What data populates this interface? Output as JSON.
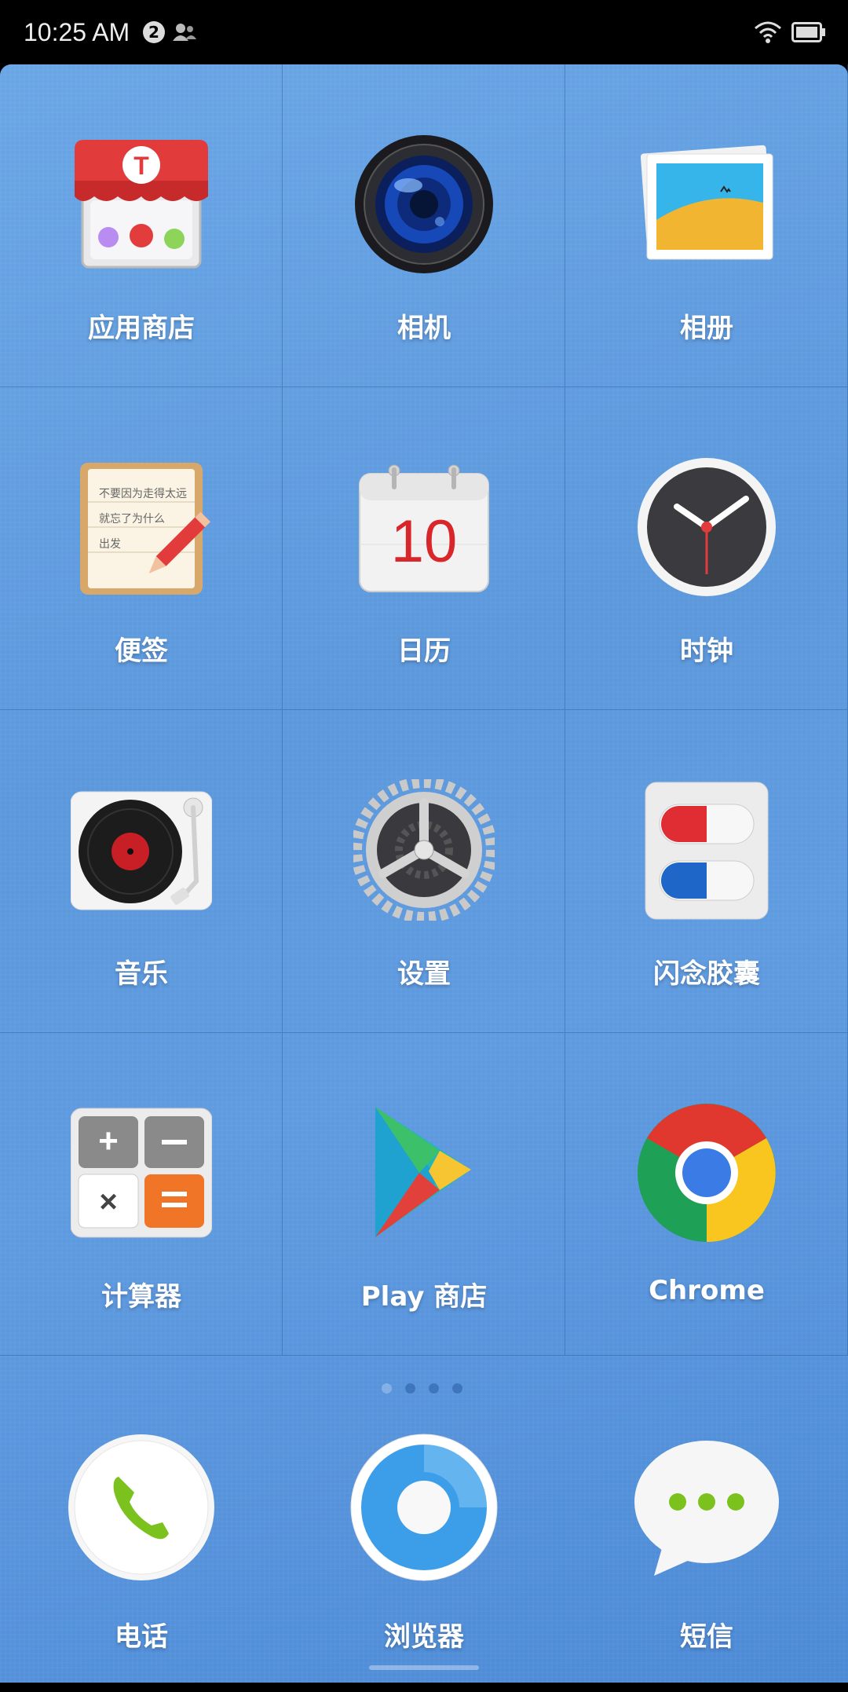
{
  "status_bar": {
    "time": "10:25 AM",
    "notification_badge": "2",
    "icons": [
      "notification-count-icon",
      "user-icon",
      "wifi-icon",
      "battery-icon"
    ]
  },
  "apps": [
    {
      "label": "应用商店",
      "icon": "app-store-icon"
    },
    {
      "label": "相机",
      "icon": "camera-icon"
    },
    {
      "label": "相册",
      "icon": "gallery-icon"
    },
    {
      "label": "便签",
      "icon": "notes-icon"
    },
    {
      "label": "日历",
      "icon": "calendar-icon",
      "date": "10"
    },
    {
      "label": "时钟",
      "icon": "clock-icon"
    },
    {
      "label": "音乐",
      "icon": "music-icon"
    },
    {
      "label": "设置",
      "icon": "settings-gear-icon"
    },
    {
      "label": "闪念胶囊",
      "icon": "capsule-icon"
    },
    {
      "label": "计算器",
      "icon": "calculator-icon"
    },
    {
      "label": "Play 商店",
      "icon": "play-store-icon"
    },
    {
      "label": "Chrome",
      "icon": "chrome-icon"
    }
  ],
  "page_indicator": {
    "pages": 4,
    "current": 1
  },
  "dock": [
    {
      "label": "电话",
      "icon": "phone-icon"
    },
    {
      "label": "浏览器",
      "icon": "browser-icon"
    },
    {
      "label": "短信",
      "icon": "messages-icon"
    }
  ],
  "notes_text": [
    "不要因为走得太远",
    "就忘了为什么",
    "出发"
  ],
  "colors": {
    "background": "#5b98dc",
    "accent_red": "#e23b3b",
    "accent_green": "#7cc21e"
  }
}
